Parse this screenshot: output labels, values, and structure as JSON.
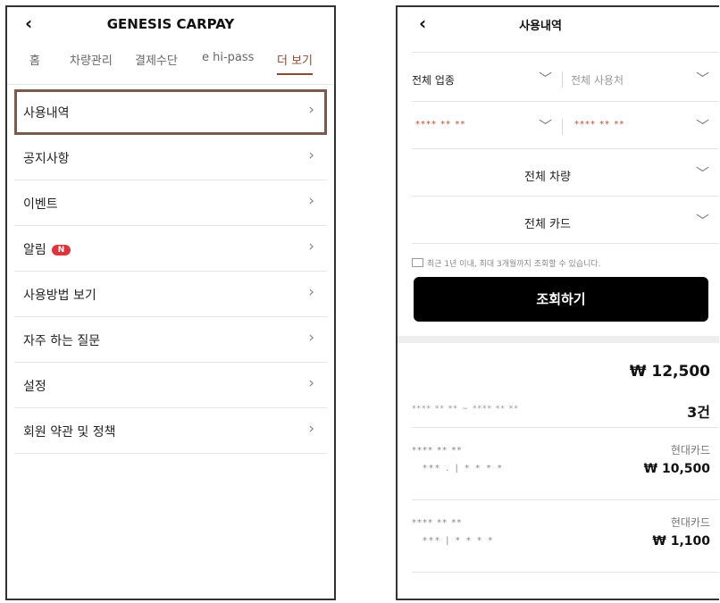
{
  "left": {
    "back": "‹",
    "title": "GENESIS CARPAY",
    "tabs": [
      "홈",
      "차량관리",
      "결제수단",
      "e hi-pass",
      "더 보기"
    ],
    "menu": [
      {
        "label": "사용내역"
      },
      {
        "label": "공지사항"
      },
      {
        "label": "이벤트"
      },
      {
        "label": "알림",
        "badge": "N"
      },
      {
        "label": "사용방법 보기"
      },
      {
        "label": "자주 하는 질문"
      },
      {
        "label": "설정"
      },
      {
        "label": "회원 약관 및 정책"
      }
    ],
    "chevron": "›",
    "accent": "#8a4a34",
    "badge_color": "#d9363e"
  },
  "right": {
    "back": "‹",
    "title": "사용내역",
    "filters": {
      "category": "전체 업종",
      "merchant": "전체 사용처",
      "date_from": "**** ** **",
      "date_to": "**** ** **",
      "vehicle": "전체 차량",
      "card": "전체 카드",
      "chevron": "﹀"
    },
    "notice": "최근 1년 이내, 최대 3개월까지 조회할 수 있습니다.",
    "query_button": "조회하기",
    "summary": {
      "total": "₩ 12,500",
      "period": "**** ** ** ~ **** ** **",
      "count": "3건"
    },
    "transactions": [
      {
        "name": "**** ** **",
        "sub": "*** . | * * * *",
        "card": "현대카드",
        "amount": "₩ 10,500"
      },
      {
        "name": "**** ** **",
        "sub": "*** | * * * *",
        "card": "현대카드",
        "amount": "₩ 1,100"
      }
    ]
  }
}
